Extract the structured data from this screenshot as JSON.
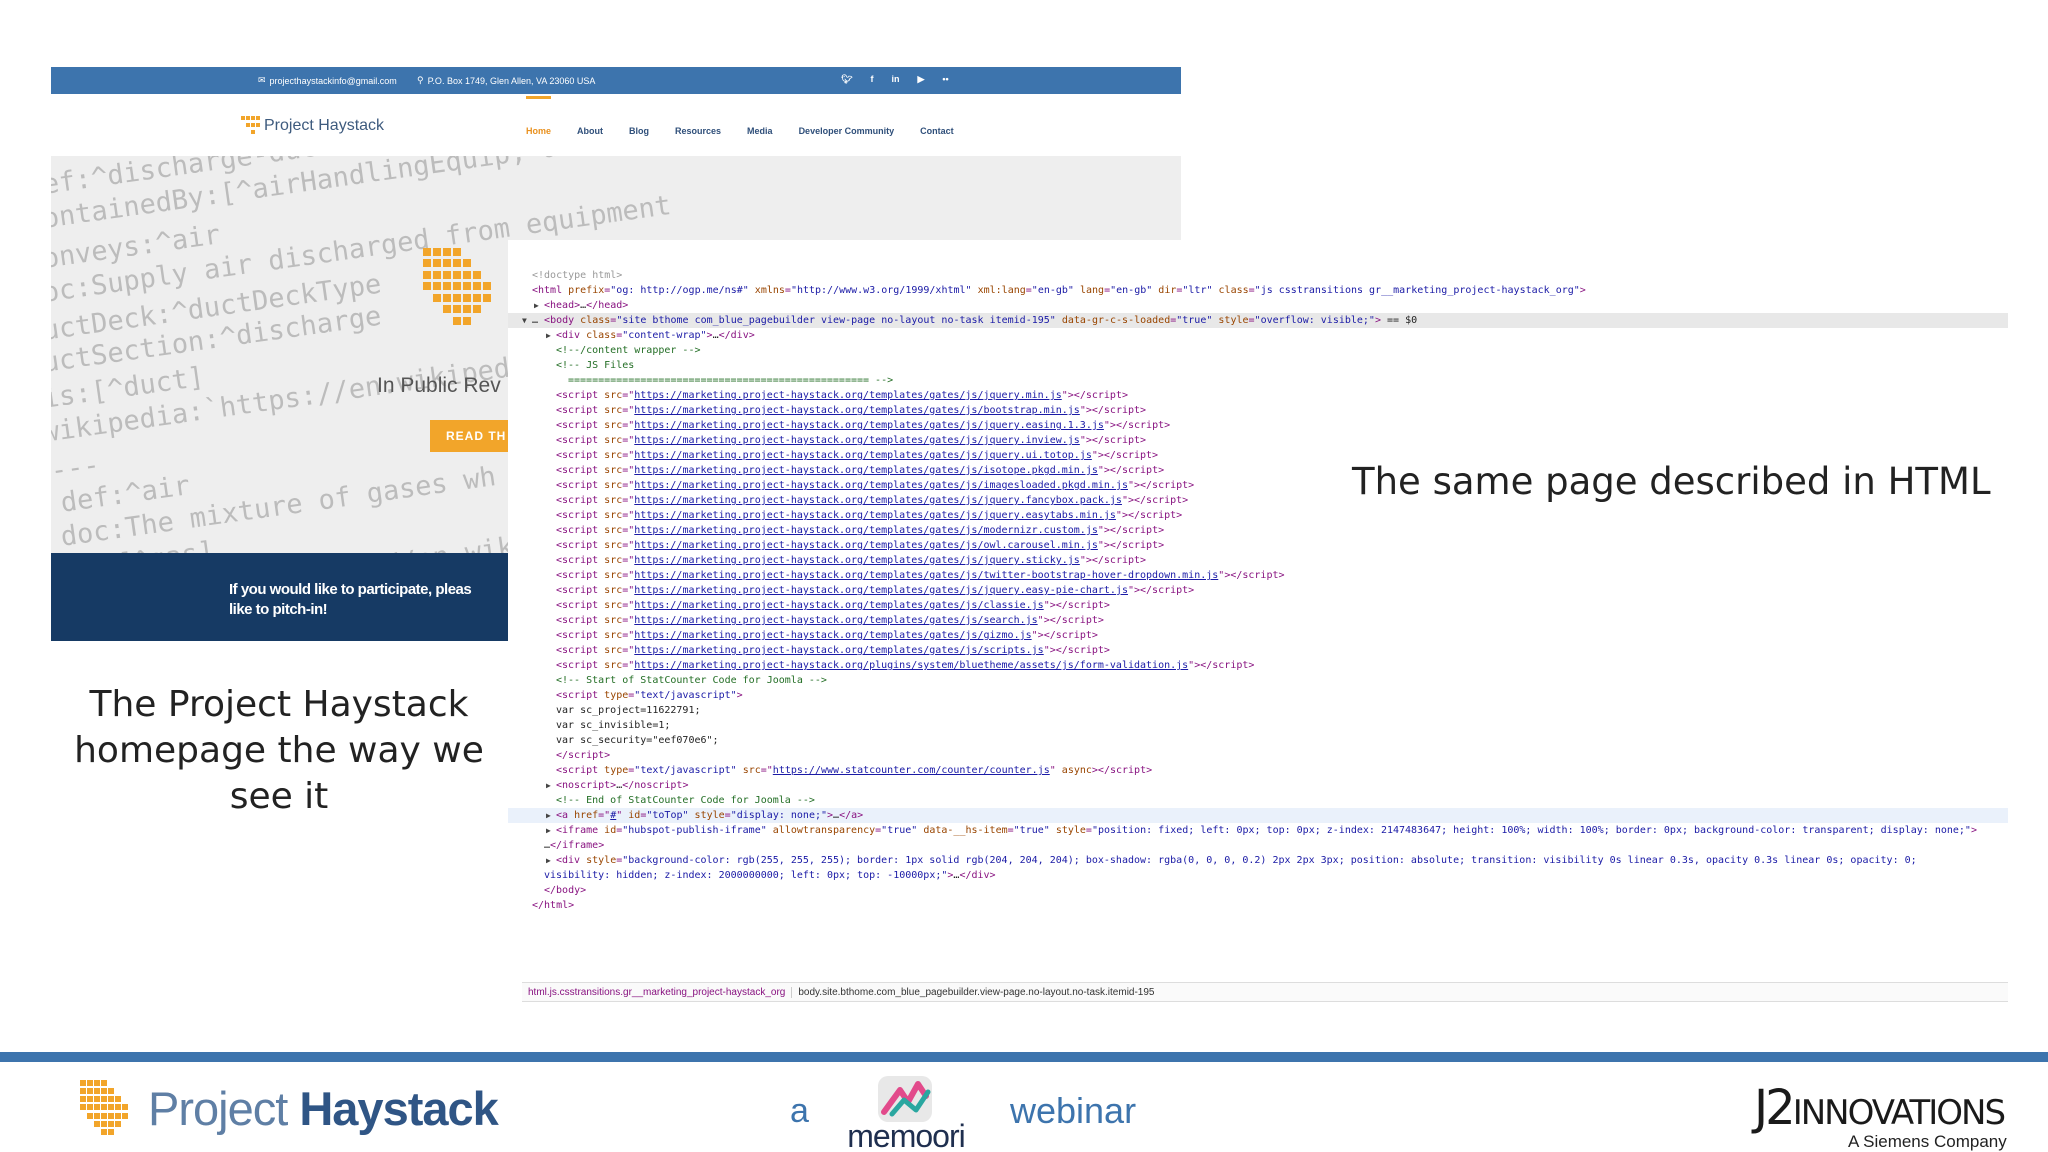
{
  "site": {
    "topbar": {
      "email": "projecthaystackinfo@gmail.com",
      "address": "P.O. Box 1749, Glen Allen, VA 23060 USA",
      "social": [
        "t",
        "f",
        "in",
        "yt",
        "fl"
      ]
    },
    "logo_text": "Project Haystack",
    "nav": [
      "Home",
      "About",
      "Blog",
      "Resources",
      "Media",
      "Developer Community",
      "Contact"
    ],
    "hero_code": [
      "ef:^discharge-duct",
      "ontainedBy:[^airHandlingEquip, air",
      "onveys:^air",
      "oc:Supply air discharged from equipment",
      "uctDeck:^ductDeckType",
      "uctSection:^discharge",
      "is:[^duct]",
      "wikipedia:`https://en.wikiped",
      "---",
      "def:^air",
      "doc:The mixture of gases wh",
      "is:[^gas]",
      "wikipedia:`https://en.wikipe"
    ],
    "hero_subtitle": "In Public Rev",
    "hero_button": "READ TH",
    "banner_line1": "If you would like to participate, pleas",
    "banner_line2": "like to pitch-in!"
  },
  "devtools": {
    "lines": [
      {
        "indent": 0,
        "tri": "",
        "html": "<span class='c-doc'>&lt;!doctype html&gt;</span>"
      },
      {
        "indent": 0,
        "tri": "",
        "html": "<span class='c-tag'>&lt;html </span><span class='c-attr'>prefix</span>=<span class='c-val'>\"og: http://ogp.me/ns#\"</span> <span class='c-attr'>xmlns</span>=<span class='c-val'>\"http://www.w3.org/1999/xhtml\"</span> <span class='c-attr'>xml:lang</span>=<span class='c-val'>\"en-gb\"</span> <span class='c-attr'>lang</span>=<span class='c-val'>\"en-gb\"</span> <span class='c-attr'>dir</span>=<span class='c-val'>\"ltr\"</span> <span class='c-attr'>class</span>=<span class='c-val'>\"js csstransitions gr__marketing_project-haystack_org\"</span><span class='c-tag'>&gt;</span>"
      },
      {
        "indent": 1,
        "tri": "▶",
        "html": "<span class='c-tag'>&lt;head&gt;</span><span class='c-txt'>…</span><span class='c-tag'>&lt;/head&gt;</span>"
      },
      {
        "indent": 0,
        "tri": "▼",
        "hl": true,
        "html": "<span class='c-txt'>… </span><span class='c-tag'>&lt;body </span><span class='c-attr'>class</span>=<span class='c-val'>\"site bthome  com_blue_pagebuilder view-page no-layout no-task itemid-195\"</span> <span class='c-attr'>data-gr-c-s-loaded</span>=<span class='c-val'>\"true\"</span> <span class='c-attr'>style</span>=<span class='c-val'>\"overflow: visible;\"</span><span class='c-tag'>&gt;</span><span class='c-txt'> == $0</span>"
      },
      {
        "indent": 2,
        "tri": "▶",
        "html": "<span class='c-tag'>&lt;div </span><span class='c-attr'>class</span>=<span class='c-val'>\"content-wrap\"</span><span class='c-tag'>&gt;</span><span class='c-txt'>…</span><span class='c-tag'>&lt;/div&gt;</span>"
      },
      {
        "indent": 2,
        "tri": "",
        "html": "<span class='c-cm'>&lt;!--/content wrapper --&gt;</span>"
      },
      {
        "indent": 2,
        "tri": "",
        "html": "<span class='c-cm'>&lt;!-- JS Files</span>"
      },
      {
        "indent": 3,
        "tri": "",
        "html": "<span class='c-cm'>==================================================  --&gt;</span>"
      },
      {
        "indent": 2,
        "tri": "",
        "html": "<span class='c-tag'>&lt;script </span><span class='c-attr'>src</span>=\"<span class='c-url'>https://marketing.project-haystack.org/templates/gates/js/jquery.min.js</span>\"<span class='c-tag'>&gt;&lt;/script&gt;</span>"
      },
      {
        "indent": 2,
        "tri": "",
        "html": "<span class='c-tag'>&lt;script </span><span class='c-attr'>src</span>=\"<span class='c-url'>https://marketing.project-haystack.org/templates/gates/js/bootstrap.min.js</span>\"<span class='c-tag'>&gt;&lt;/script&gt;</span>"
      },
      {
        "indent": 2,
        "tri": "",
        "html": "<span class='c-tag'>&lt;script </span><span class='c-attr'>src</span>=\"<span class='c-url'>https://marketing.project-haystack.org/templates/gates/js/jquery.easing.1.3.js</span>\"<span class='c-tag'>&gt;&lt;/script&gt;</span>"
      },
      {
        "indent": 2,
        "tri": "",
        "html": "<span class='c-tag'>&lt;script </span><span class='c-attr'>src</span>=\"<span class='c-url'>https://marketing.project-haystack.org/templates/gates/js/jquery.inview.js</span>\"<span class='c-tag'>&gt;&lt;/script&gt;</span>"
      },
      {
        "indent": 2,
        "tri": "",
        "html": "<span class='c-tag'>&lt;script </span><span class='c-attr'>src</span>=\"<span class='c-url'>https://marketing.project-haystack.org/templates/gates/js/jquery.ui.totop.js</span>\"<span class='c-tag'>&gt;&lt;/script&gt;</span>"
      },
      {
        "indent": 2,
        "tri": "",
        "html": "<span class='c-tag'>&lt;script </span><span class='c-attr'>src</span>=\"<span class='c-url'>https://marketing.project-haystack.org/templates/gates/js/isotope.pkgd.min.js</span>\"<span class='c-tag'>&gt;&lt;/script&gt;</span>"
      },
      {
        "indent": 2,
        "tri": "",
        "html": "<span class='c-tag'>&lt;script </span><span class='c-attr'>src</span>=\"<span class='c-url'>https://marketing.project-haystack.org/templates/gates/js/imagesloaded.pkgd.min.js</span>\"<span class='c-tag'>&gt;&lt;/script&gt;</span>"
      },
      {
        "indent": 2,
        "tri": "",
        "html": "<span class='c-tag'>&lt;script </span><span class='c-attr'>src</span>=\"<span class='c-url'>https://marketing.project-haystack.org/templates/gates/js/jquery.fancybox.pack.js</span>\"<span class='c-tag'>&gt;&lt;/script&gt;</span>"
      },
      {
        "indent": 2,
        "tri": "",
        "html": "<span class='c-tag'>&lt;script </span><span class='c-attr'>src</span>=\"<span class='c-url'>https://marketing.project-haystack.org/templates/gates/js/jquery.easytabs.min.js</span>\"<span class='c-tag'>&gt;&lt;/script&gt;</span>"
      },
      {
        "indent": 2,
        "tri": "",
        "html": "<span class='c-tag'>&lt;script </span><span class='c-attr'>src</span>=\"<span class='c-url'>https://marketing.project-haystack.org/templates/gates/js/modernizr.custom.js</span>\"<span class='c-tag'>&gt;&lt;/script&gt;</span>"
      },
      {
        "indent": 2,
        "tri": "",
        "html": "<span class='c-tag'>&lt;script </span><span class='c-attr'>src</span>=\"<span class='c-url'>https://marketing.project-haystack.org/templates/gates/js/owl.carousel.min.js</span>\"<span class='c-tag'>&gt;&lt;/script&gt;</span>"
      },
      {
        "indent": 2,
        "tri": "",
        "html": "<span class='c-tag'>&lt;script </span><span class='c-attr'>src</span>=\"<span class='c-url'>https://marketing.project-haystack.org/templates/gates/js/jquery.sticky.js</span>\"<span class='c-tag'>&gt;&lt;/script&gt;</span>"
      },
      {
        "indent": 2,
        "tri": "",
        "html": "<span class='c-tag'>&lt;script </span><span class='c-attr'>src</span>=\"<span class='c-url'>https://marketing.project-haystack.org/templates/gates/js/twitter-bootstrap-hover-dropdown.min.js</span>\"<span class='c-tag'>&gt;&lt;/script&gt;</span>"
      },
      {
        "indent": 2,
        "tri": "",
        "html": "<span class='c-tag'>&lt;script </span><span class='c-attr'>src</span>=\"<span class='c-url'>https://marketing.project-haystack.org/templates/gates/js/jquery.easy-pie-chart.js</span>\"<span class='c-tag'>&gt;&lt;/script&gt;</span>"
      },
      {
        "indent": 2,
        "tri": "",
        "html": "<span class='c-tag'>&lt;script </span><span class='c-attr'>src</span>=\"<span class='c-url'>https://marketing.project-haystack.org/templates/gates/js/classie.js</span>\"<span class='c-tag'>&gt;&lt;/script&gt;</span>"
      },
      {
        "indent": 2,
        "tri": "",
        "html": "<span class='c-tag'>&lt;script </span><span class='c-attr'>src</span>=\"<span class='c-url'>https://marketing.project-haystack.org/templates/gates/js/search.js</span>\"<span class='c-tag'>&gt;&lt;/script&gt;</span>"
      },
      {
        "indent": 2,
        "tri": "",
        "html": "<span class='c-tag'>&lt;script </span><span class='c-attr'>src</span>=\"<span class='c-url'>https://marketing.project-haystack.org/templates/gates/js/gizmo.js</span>\"<span class='c-tag'>&gt;&lt;/script&gt;</span>"
      },
      {
        "indent": 2,
        "tri": "",
        "html": "<span class='c-tag'>&lt;script </span><span class='c-attr'>src</span>=\"<span class='c-url'>https://marketing.project-haystack.org/templates/gates/js/scripts.js</span>\"<span class='c-tag'>&gt;&lt;/script&gt;</span>"
      },
      {
        "indent": 2,
        "tri": "",
        "html": "<span class='c-tag'>&lt;script </span><span class='c-attr'>src</span>=\"<span class='c-url'>https://marketing.project-haystack.org/plugins/system/bluetheme/assets/js/form-validation.js</span>\"<span class='c-tag'>&gt;&lt;/script&gt;</span>"
      },
      {
        "indent": 2,
        "tri": "",
        "html": "<span class='c-cm'>&lt;!-- Start of StatCounter Code for Joomla --&gt;</span>"
      },
      {
        "indent": 2,
        "tri": "",
        "html": "<span class='c-tag'>&lt;script </span><span class='c-attr'>type</span>=<span class='c-val'>\"text/javascript\"</span><span class='c-tag'>&gt;</span>"
      },
      {
        "indent": 2,
        "tri": "",
        "html": "<span class='c-txt'>var sc_project=11622791;</span>"
      },
      {
        "indent": 2,
        "tri": "",
        "html": "<span class='c-txt'>var sc_invisible=1;</span>"
      },
      {
        "indent": 2,
        "tri": "",
        "html": "<span class='c-txt'>var sc_security=\"eef070e6\";</span>"
      },
      {
        "indent": 2,
        "tri": "",
        "html": "<span class='c-tag'>&lt;/script&gt;</span>"
      },
      {
        "indent": 2,
        "tri": "",
        "html": "<span class='c-tag'>&lt;script </span><span class='c-attr'>type</span>=<span class='c-val'>\"text/javascript\"</span> <span class='c-attr'>src</span>=\"<span class='c-url'>https://www.statcounter.com/counter/counter.js</span>\" <span class='c-attr'>async</span><span class='c-tag'>&gt;&lt;/script&gt;</span>"
      },
      {
        "indent": 2,
        "tri": "▶",
        "html": "<span class='c-tag'>&lt;noscript&gt;</span><span class='c-txt'>…</span><span class='c-tag'>&lt;/noscript&gt;</span>"
      },
      {
        "indent": 2,
        "tri": "",
        "html": "<span class='c-cm'>&lt;!-- End of StatCounter Code for Joomla --&gt;</span>"
      },
      {
        "indent": 2,
        "tri": "▶",
        "hover": true,
        "html": "<span class='c-tag'>&lt;a </span><span class='c-attr'>href</span>=\"<span class='c-url'>#</span>\" <span class='c-attr'>id</span>=<span class='c-val'>\"toTop\"</span> <span class='c-attr'>style</span>=<span class='c-val'>\"display: none;\"</span><span class='c-tag'>&gt;</span><span class='c-txt'>…</span><span class='c-tag'>&lt;/a&gt;</span>"
      },
      {
        "indent": 2,
        "tri": "▶",
        "html": "<span class='c-tag'>&lt;iframe </span><span class='c-attr'>id</span>=<span class='c-val'>\"hubspot-publish-iframe\"</span> <span class='c-attr'>allowtransparency</span>=<span class='c-val'>\"true\"</span> <span class='c-attr'>data-__hs-item</span>=<span class='c-val'>\"true\"</span> <span class='c-attr'>style</span>=<span class='c-val'>\"position: fixed; left: 0px; top: 0px; z-index: 2147483647; height: 100%; width: 100%; border: 0px; background-color: transparent; display: none;\"</span><span class='c-tag'>&gt;</span>"
      },
      {
        "indent": 1,
        "tri": "",
        "html": "<span class='c-txt'>…</span><span class='c-tag'>&lt;/iframe&gt;</span>"
      },
      {
        "indent": 2,
        "tri": "▶",
        "html": "<span class='c-tag'>&lt;div </span><span class='c-attr'>style</span>=<span class='c-val'>\"background-color: rgb(255, 255, 255); border: 1px solid rgb(204, 204, 204); box-shadow: rgba(0, 0, 0, 0.2) 2px 2px 3px; position: absolute; transition: visibility 0s linear 0.3s, opacity 0.3s linear 0s; opacity: 0;</span>"
      },
      {
        "indent": 1,
        "tri": "",
        "html": "<span class='c-val'>visibility: hidden; z-index: 2000000000; left: 0px; top: -10000px;\"</span><span class='c-tag'>&gt;</span><span class='c-txt'>…</span><span class='c-tag'>&lt;/div&gt;</span>"
      },
      {
        "indent": 1,
        "tri": "",
        "html": "<span class='c-tag'>&lt;/body&gt;</span>"
      },
      {
        "indent": 0,
        "tri": "",
        "html": "<span class='c-tag'>&lt;/html&gt;</span>"
      }
    ],
    "breadcrumb_html": "html.js.csstransitions.gr__marketing_project-haystack_org",
    "breadcrumb_body": "body.site.bthome.com_blue_pagebuilder.view-page.no-layout.no-task.itemid-195"
  },
  "captions": {
    "left": "The Project Haystack homepage the way we see it",
    "right": "The same page described in HTML"
  },
  "footer": {
    "logo_project": "Project ",
    "logo_haystack": "Haystack",
    "a": "a",
    "memoori": "memoori",
    "webinar": "webinar",
    "j2_main": "J2",
    "j2_word": "INNOVATIONS",
    "j2_sub": "A Siemens Company"
  },
  "colors": {
    "brand_blue": "#3d74ad",
    "haystack_orange": "#f2a52a",
    "banner_navy": "#163a64"
  }
}
